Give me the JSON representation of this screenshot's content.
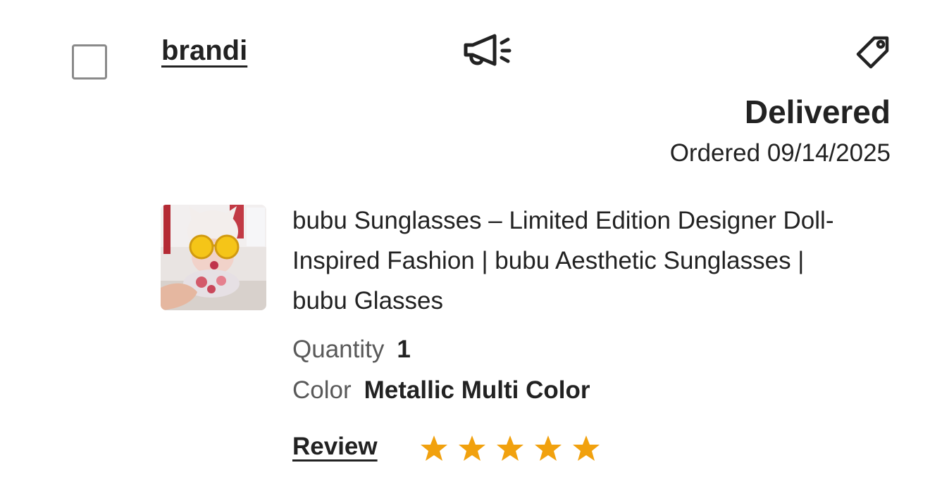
{
  "order": {
    "buyer_name": "brandi",
    "status": "Delivered",
    "ordered_text": "Ordered 09/14/2025"
  },
  "icons": {
    "announce": "megaphone-icon",
    "tag": "tag-icon"
  },
  "item": {
    "title": "bubu Sunglasses – Limited Edition Designer Doll-Inspired Fashion | bubu Aesthetic Sunglasses | bubu Glasses",
    "quantity_label": "Quantity",
    "quantity_value": "1",
    "color_label": "Color",
    "color_value": "Metallic Multi Color"
  },
  "review": {
    "label": "Review",
    "rating": 5,
    "max": 5,
    "star_color": "#f1a10e"
  },
  "colors": {
    "text": "#222222",
    "muted": "#595959",
    "checkbox_border": "#8a8a8a"
  }
}
